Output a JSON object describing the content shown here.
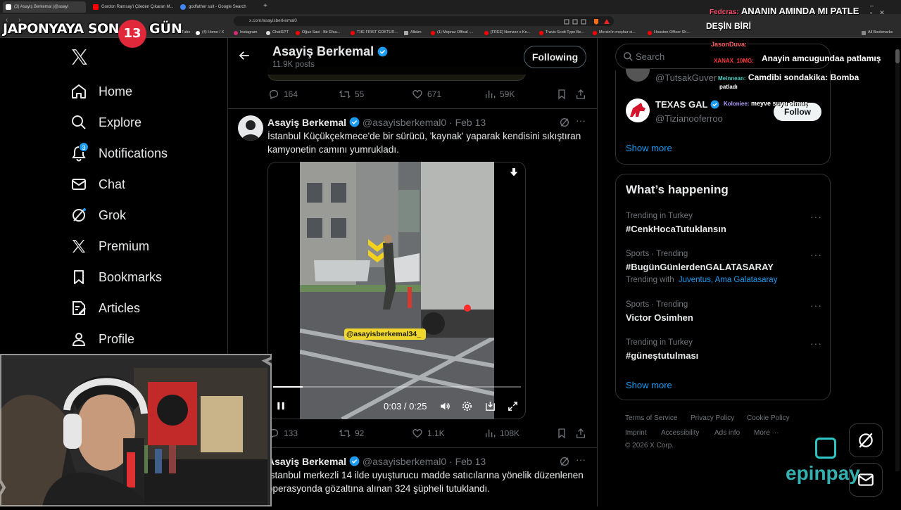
{
  "browser": {
    "tabs": [
      {
        "title": "(3) Asayiş Berkemal (@asayi",
        "color": "#ffffff"
      },
      {
        "title": "Gordon Ramsay'i Çileden Çıkaran M...",
        "color": "#ff0000"
      },
      {
        "title": "godfather suit - Google Search",
        "color": "#4285f4"
      }
    ],
    "url": "x.com/asayisberkemal0",
    "bookmarks": [
      "uTube",
      "(4) Home / X",
      "Instagram",
      "ChatGPT",
      "Oğuz Sasi - Bir Efsa...",
      "THE FIRST GOKTUR...",
      "Albüm",
      "(1) Mepraz Offical -...",
      "[FREE] Nemzzz x Ke...",
      "Travis Scott Type Be...",
      "Mersin'in meşhur ci...",
      "Houston Officer Sh...",
      "All Bookmarks"
    ]
  },
  "overlay": {
    "countdown_prefix": "JAPONYAYA SON",
    "countdown_number": "13",
    "countdown_suffix": "GÜN"
  },
  "nav": {
    "items": [
      {
        "label": "Home",
        "icon": "home-icon"
      },
      {
        "label": "Explore",
        "icon": "search-icon"
      },
      {
        "label": "Notifications",
        "icon": "bell-icon",
        "badge": "3"
      },
      {
        "label": "Chat",
        "icon": "mail-icon"
      },
      {
        "label": "Grok",
        "icon": "grok-icon"
      },
      {
        "label": "Premium",
        "icon": "x-icon"
      },
      {
        "label": "Bookmarks",
        "icon": "bookmark-icon"
      },
      {
        "label": "Articles",
        "icon": "article-icon"
      },
      {
        "label": "Profile",
        "icon": "profile-icon"
      }
    ]
  },
  "profile_header": {
    "name": "Asayiş Berkemal",
    "posts": "11.9K posts",
    "follow_button": "Following"
  },
  "tweet0": {
    "replies": "164",
    "retweets": "55",
    "likes": "671",
    "views": "59K"
  },
  "tweet1": {
    "name": "Asayiş Berkemal",
    "handle": "@asayisberkemal0",
    "date": "· Feb 13",
    "text": "İstanbul Küçükçekmece'de bir sürücü, 'kaynak' yaparak kendisini sıkıştıran kamyonetin camını yumrukladı.",
    "video_watermark": "@asayisberkemal34_",
    "video_time": "0:03 / 0:25",
    "video_progress": 0.12,
    "replies": "133",
    "retweets": "92",
    "likes": "1.1K",
    "views": "108K"
  },
  "tweet2": {
    "name": "Asayiş Berkemal",
    "handle": "@asayisberkemal0",
    "date": "· Feb 13",
    "text": "İstanbul merkezli 14 ilde uyuşturucu madde satıcılarına yönelik düzenlenen operasyonda gözaltına alınan 324 şüpheli tutuklandı."
  },
  "right": {
    "search_placeholder": "Search",
    "who_to_follow": [
      {
        "handle": "@TutsakGuver"
      },
      {
        "name": "TEXAS GAL",
        "handle": "@Tizianooferroo",
        "button": "Follow"
      }
    ],
    "show_more": "Show more",
    "happening_title": "What’s happening",
    "trends": [
      {
        "meta": "Trending in Turkey",
        "name": "#CenkHocaTutuklansın"
      },
      {
        "meta": "Sports · Trending",
        "name": "#BugünGünlerdenGALATASARAY",
        "with_prefix": "Trending with",
        "with": "Juventus, Ama Galatasaray"
      },
      {
        "meta": "Sports · Trending",
        "name": "Victor Osimhen"
      },
      {
        "meta": "Trending in Turkey",
        "name": "#güneştutulması"
      }
    ],
    "show_more2": "Show more",
    "footer": [
      "Terms of Service",
      "Privacy Policy",
      "Cookie Policy",
      "Imprint",
      "Accessibility",
      "Ads info",
      "More ···",
      "© 2026 X Corp."
    ]
  },
  "chat": [
    {
      "user": "Fedcras:",
      "msg": "ANANIN AMINDA MI PATLE",
      "color": "#ff4d6d"
    },
    {
      "user": "",
      "msg": "DEŞİN BİRİ",
      "color": "#ffffff"
    },
    {
      "user": "JasonDuva:",
      "msg": "",
      "color": "#ff5c5c"
    },
    {
      "user": "",
      "msg": "Anayin amcugundaa patlamış",
      "color": "#ffffff"
    },
    {
      "user": "XANAX_10MG:",
      "msg": "",
      "color": "#ff3b3b"
    },
    {
      "user": "Meinnean:",
      "msg": "Camdibi sondakika: Bomba",
      "color": "#4fd1c5"
    },
    {
      "user": "",
      "msg": "patladı",
      "color": "#ffffff"
    },
    {
      "user": "Koloniee:",
      "msg": "meyve suyu olmuş",
      "color": "#b39dff"
    }
  ],
  "sponsor": "epinpay",
  "colors": {
    "accent": "#1d9bf0",
    "muted": "#71767b",
    "text": "#e7e9ea",
    "border": "#2f3336",
    "link": "#1d9bf0"
  }
}
